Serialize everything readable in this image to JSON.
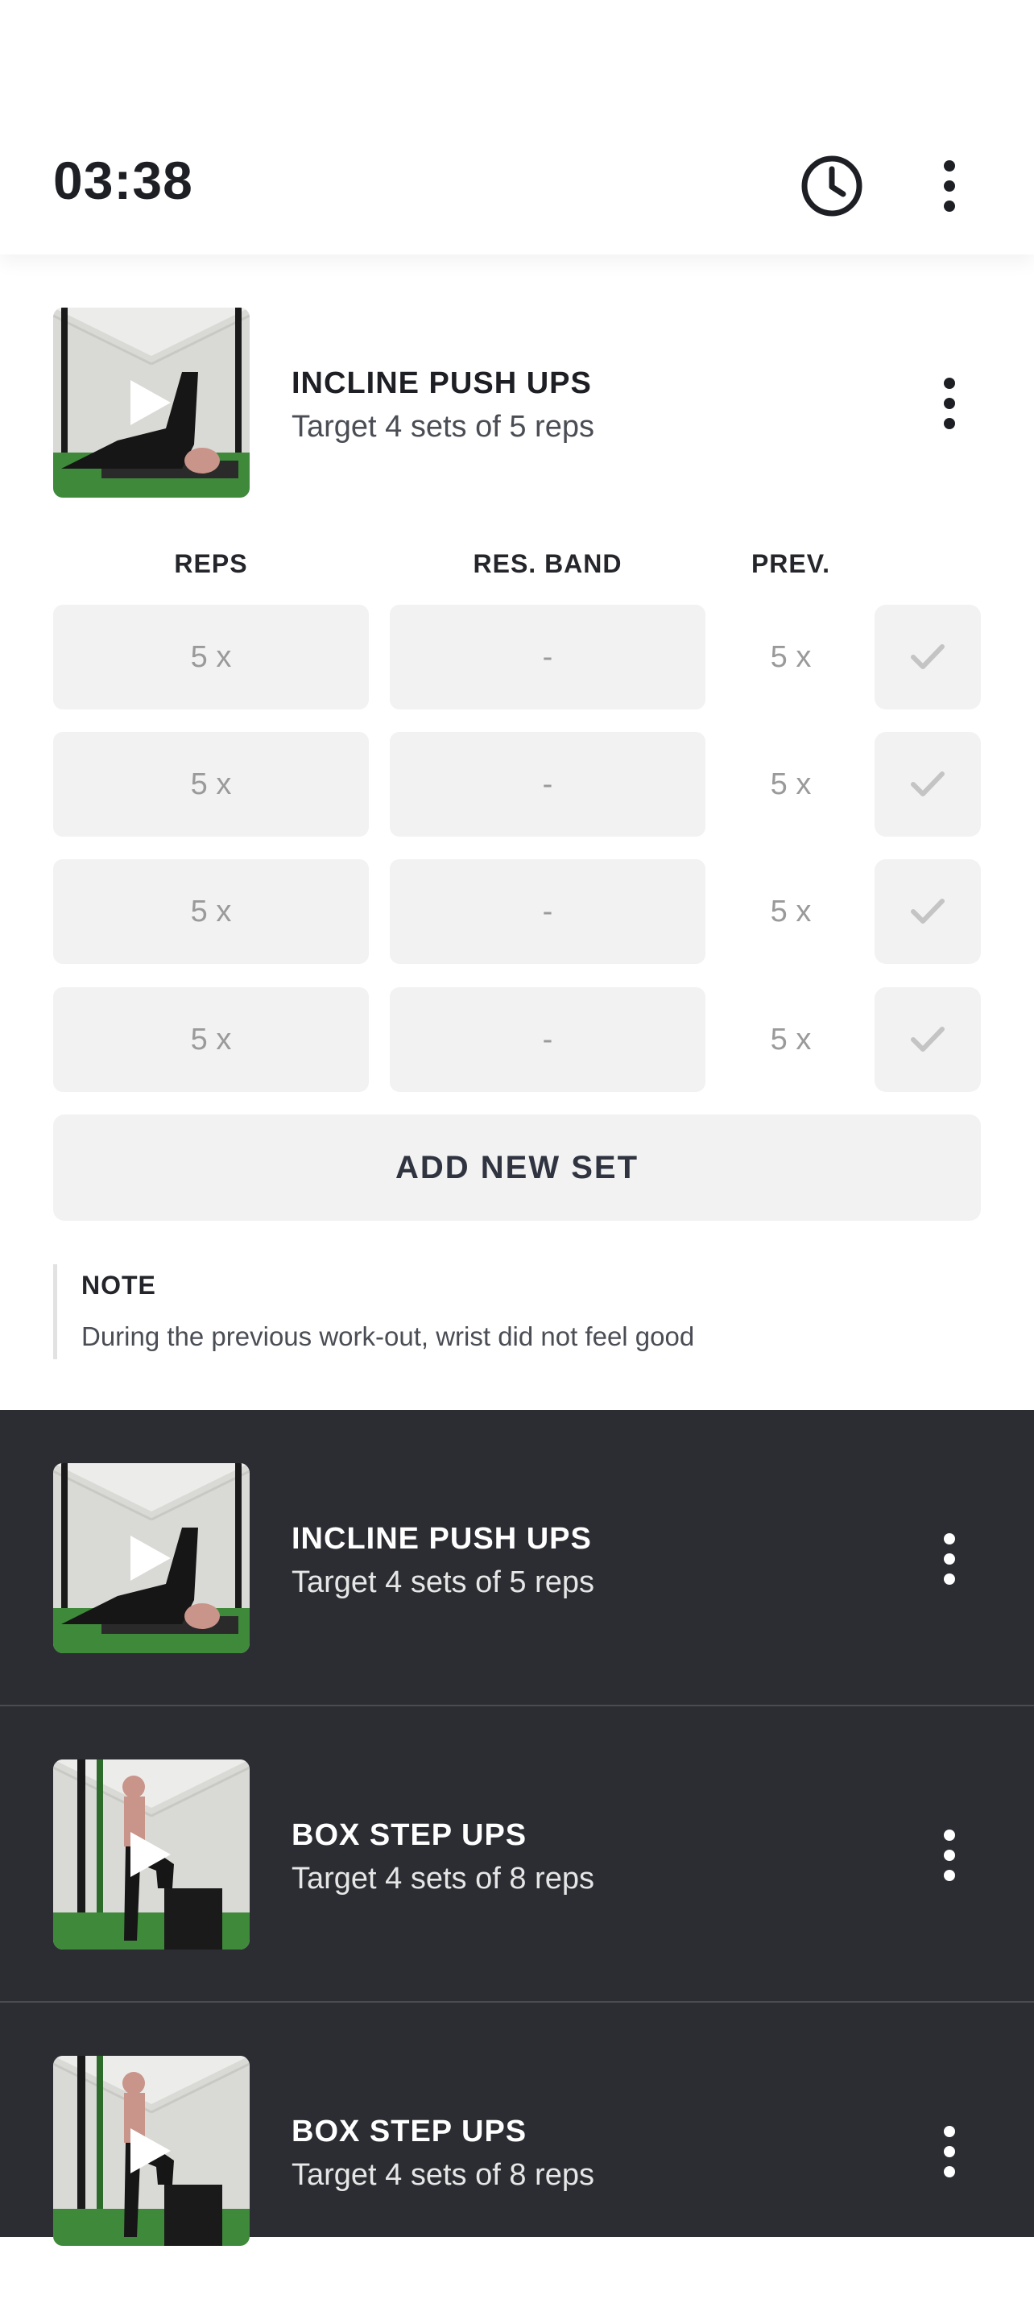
{
  "header": {
    "timer": "03:38",
    "clock_icon": "clock-icon",
    "menu_icon": "more-vertical-icon"
  },
  "active_exercise": {
    "title": "INCLINE PUSH UPS",
    "subtitle": "Target 4 sets of 5 reps",
    "thumbnail_icon": "play-icon",
    "columns": [
      "REPS",
      "RES. BAND",
      "PREV."
    ],
    "sets": [
      {
        "reps": "5 x",
        "band": "-",
        "prev": "5 x"
      },
      {
        "reps": "5 x",
        "band": "-",
        "prev": "5 x"
      },
      {
        "reps": "5 x",
        "band": "-",
        "prev": "5 x"
      },
      {
        "reps": "5 x",
        "band": "-",
        "prev": "5 x"
      }
    ],
    "add_set_label": "ADD NEW SET",
    "note": {
      "title": "NOTE",
      "text": "During the previous work-out, wrist did not feel good"
    }
  },
  "exercise_list": [
    {
      "title": "INCLINE PUSH UPS",
      "subtitle": "Target 4 sets of 5 reps"
    },
    {
      "title": "BOX STEP UPS",
      "subtitle": "Target 4 sets of 8 reps"
    },
    {
      "title": "BOX STEP UPS",
      "subtitle": "Target 4 sets of 8 reps"
    }
  ],
  "colors": {
    "dark_bg": "#2b2d32",
    "cell_bg": "#f2f2f2",
    "text_dark": "#1d1f24",
    "text_muted": "#9a9a9a"
  }
}
